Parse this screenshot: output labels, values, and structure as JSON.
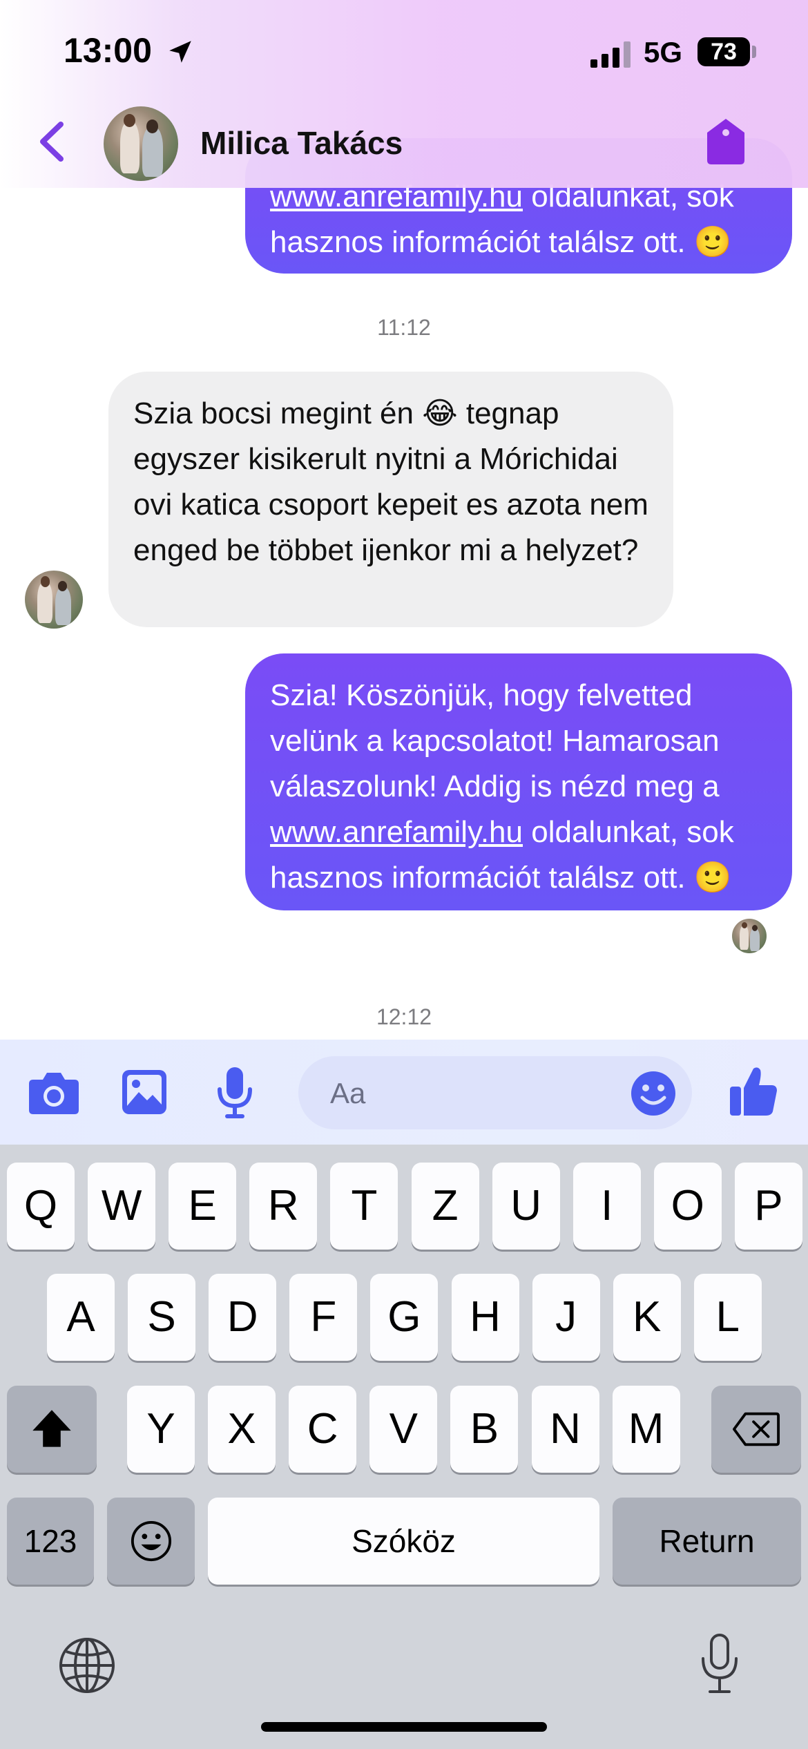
{
  "status_bar": {
    "time": "13:00",
    "network": "5G",
    "battery": "73"
  },
  "header": {
    "contact_name": "Milica Takács"
  },
  "messages": {
    "top_partial_link": "www.anrefamily.hu",
    "top_partial_line1_rest": " oldalunkat, sok",
    "top_partial_line2": "hasznos információt találsz ott. 🙂",
    "timestamp_1": "11:12",
    "incoming_text": "Szia bocsi megint én 😂 tegnap egyszer kisikerult nyitni a Mórichidai ovi katica csoport kepeit es azota nem enged be többet ijenkor mi a helyzet?",
    "outgoing_text_before_link": "Szia! Köszönjük, hogy felvetted velünk a kapcsolatot! Hamarosan válaszolunk! Addig is nézd meg a ",
    "outgoing_link": "www.anrefamily.hu",
    "outgoing_text_after_link": " oldalunkat, sok hasznos információt találsz ott. 🙂",
    "timestamp_2": "12:12"
  },
  "composer": {
    "placeholder": "Aa"
  },
  "keyboard": {
    "row1": [
      "Q",
      "W",
      "E",
      "R",
      "T",
      "Z",
      "U",
      "I",
      "O",
      "P"
    ],
    "row2": [
      "A",
      "S",
      "D",
      "F",
      "G",
      "H",
      "J",
      "K",
      "L"
    ],
    "row3": [
      "Y",
      "X",
      "C",
      "V",
      "B",
      "N",
      "M"
    ],
    "numbers_label": "123",
    "space_label": "Szóköz",
    "return_label": "Return"
  },
  "colors": {
    "accent": "#7b3fe4",
    "bubble_out": "#6a56f7",
    "icon_blue": "#4a5cf0"
  }
}
